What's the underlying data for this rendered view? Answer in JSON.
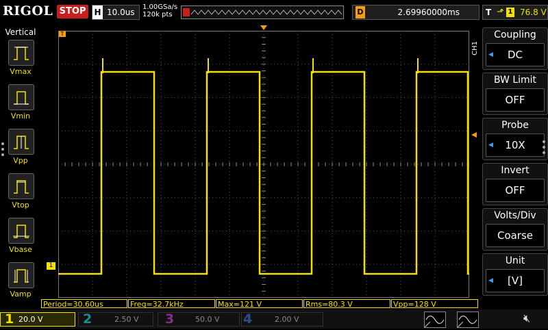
{
  "brand": {
    "logo_text": "RIGOL"
  },
  "status": {
    "run_state": "STOP"
  },
  "horizontal": {
    "tag": "H",
    "timebase": "10.0us",
    "sample_rate": "1.00GSa/s",
    "memory_depth": "120k pts"
  },
  "trigger_position": {
    "tag": "D",
    "value": "2.69960000ms"
  },
  "trigger": {
    "tag": "T",
    "edge_icon": "rising-edge-icon",
    "source": "1",
    "level": "76.8 V"
  },
  "left_panel": {
    "title": "Vertical",
    "items": [
      {
        "label": "Vmax"
      },
      {
        "label": "Vmin"
      },
      {
        "label": "Vpp"
      },
      {
        "label": "Vtop"
      },
      {
        "label": "Vbase"
      },
      {
        "label": "Vamp"
      }
    ]
  },
  "right_panel": {
    "channel_tag": "CH1",
    "groups": [
      {
        "header": "Coupling",
        "value": "DC"
      },
      {
        "header": "BW Limit",
        "value": "OFF"
      },
      {
        "header": "Probe",
        "value": "10X"
      },
      {
        "header": "Invert",
        "value": "OFF"
      },
      {
        "header": "Volts/Div",
        "value": "Coarse"
      },
      {
        "header": "Unit",
        "value": "[V]"
      }
    ]
  },
  "measurements": [
    {
      "text": "Period=30.60us"
    },
    {
      "text": "Freq=32.7kHz"
    },
    {
      "text": "Max=121 V"
    },
    {
      "text": "Rms=80.3 V"
    },
    {
      "text": "Vpp=128 V"
    }
  ],
  "channels": [
    {
      "num": "1",
      "scale": "20.0 V",
      "color": "#f5e000",
      "active": true
    },
    {
      "num": "2",
      "scale": "2.50 V",
      "color": "#1e8c8c",
      "active": false
    },
    {
      "num": "3",
      "scale": "50.0 V",
      "color": "#8c2c8c",
      "active": false
    },
    {
      "num": "4",
      "scale": "2.00 V",
      "color": "#2c4c8c",
      "active": false
    }
  ],
  "markers": {
    "ch1_ground": "1",
    "trigger_time": "T"
  },
  "colors": {
    "trace": "#f5e000",
    "grid": "#5a5a5a",
    "stop": "#c81e1e",
    "trigger_marker": "#f39c12",
    "accent": "#3aa0ff"
  }
}
